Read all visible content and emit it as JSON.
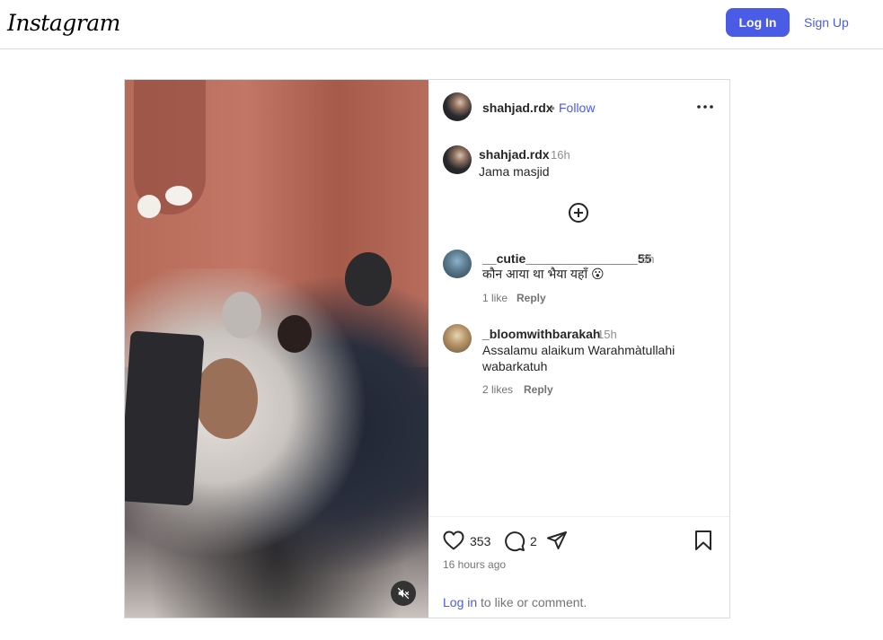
{
  "header": {
    "logo_text": "Instagram",
    "login_label": "Log In",
    "signup_label": "Sign Up"
  },
  "post": {
    "author": "shahjad.rdx",
    "follow_separator": "•",
    "follow_label": "Follow",
    "caption": {
      "author": "shahjad.rdx",
      "time": "16h",
      "text": "Jama masjid"
    },
    "comments": [
      {
        "author": "__cutie________________55",
        "time": "6h",
        "text": "कौन आया था भैया यहाँ 😮",
        "likes": "1 like",
        "reply_label": "Reply"
      },
      {
        "author": "_bloomwithbarakah",
        "time": "15h",
        "text_line1": "Assalamu alaikum Warahmàtullahi",
        "text_line2": "wabarkatuh",
        "likes": "2 likes",
        "reply_label": "Reply"
      }
    ],
    "like_count": "353",
    "comment_count": "2",
    "timestamp": "16 hours ago",
    "login_prompt_link": "Log in",
    "login_prompt_rest": " to like or comment."
  },
  "icons": {
    "more": "more-options-icon",
    "add": "plus-circle-icon",
    "like": "heart-icon",
    "comment": "comment-bubble-icon",
    "share": "share-send-icon",
    "save": "bookmark-icon",
    "mute": "speaker-muted-icon"
  },
  "colors": {
    "accent": "#4a5be6",
    "border": "#dbdbdb",
    "muted_text": "#737373"
  }
}
